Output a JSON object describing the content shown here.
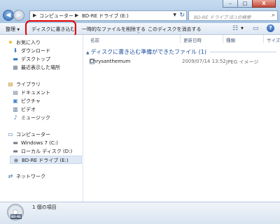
{
  "window": {
    "minimize_glyph": "–",
    "maximize_glyph": "□",
    "close_glyph": "X"
  },
  "address": {
    "separator": "▶",
    "crumbs": [
      "コンピューター",
      "BD-RE ドライブ (E:)"
    ],
    "back_glyph": "◀",
    "forward_glyph": "▶",
    "dropdown_glyph": "▼",
    "refresh_glyph": "↻"
  },
  "search": {
    "placeholder": "BD-RE ドライブ (E:)の検索",
    "icon_glyph": "⌕"
  },
  "toolbar": {
    "organize": "整理",
    "organize_drop": "▼",
    "burn": "ディスクに書き込む",
    "delete_temp": "一時的なファイルを削除する",
    "erase_disc": "このディスクを消去する",
    "views_glyph": "☷",
    "views_drop": "▼",
    "preview_glyph": "▭",
    "help_glyph": "?"
  },
  "nav": {
    "favorites": {
      "label": "お気に入り",
      "icon": "star-icon",
      "glyph": "★"
    },
    "favorites_items": [
      {
        "label": "ダウンロード",
        "icon": "download-folder-icon",
        "glyph": "⬇"
      },
      {
        "label": "デスクトップ",
        "icon": "desktop-icon",
        "glyph": "▬"
      },
      {
        "label": "最近表示した場所",
        "icon": "recent-places-icon",
        "glyph": "▦"
      }
    ],
    "libraries": {
      "label": "ライブラリ",
      "icon": "library-icon",
      "glyph": "▤"
    },
    "libraries_items": [
      {
        "label": "ドキュメント",
        "icon": "documents-icon",
        "glyph": "▤"
      },
      {
        "label": "ピクチャ",
        "icon": "pictures-icon",
        "glyph": "▣"
      },
      {
        "label": "ビデオ",
        "icon": "videos-icon",
        "glyph": "▥"
      },
      {
        "label": "ミュージック",
        "icon": "music-icon",
        "glyph": "♪"
      }
    ],
    "computer": {
      "label": "コンピューター",
      "icon": "computer-icon",
      "glyph": "▭"
    },
    "computer_items": [
      {
        "label": "Windows 7 (C:)",
        "icon": "hard-drive-icon",
        "glyph": "▬"
      },
      {
        "label": "ローカル ディスク (D:)",
        "icon": "hard-drive-icon",
        "glyph": "▬"
      },
      {
        "label": "BD-RE ドライブ (E:)",
        "icon": "bd-drive-icon",
        "glyph": "◉"
      }
    ],
    "network": {
      "label": "ネットワーク",
      "icon": "network-icon",
      "glyph": "⇄"
    }
  },
  "columns": {
    "name": "名前",
    "modified": "更新日時",
    "type": "種類",
    "size": "サイズ",
    "sort_glyph": "^"
  },
  "group": {
    "tri_glyph": "▲",
    "title": "ディスクに書き込む準備ができたファイル (1)"
  },
  "files": [
    {
      "name": "Chrysanthemum",
      "modified": "2009/07/14 13:52",
      "type": "JPEG イメージ"
    }
  ],
  "status": {
    "count": "1 個の項目",
    "disc_label": "BD-RE"
  },
  "colors": {
    "accent": "#1e4e9c",
    "highlight": "#e20000"
  }
}
